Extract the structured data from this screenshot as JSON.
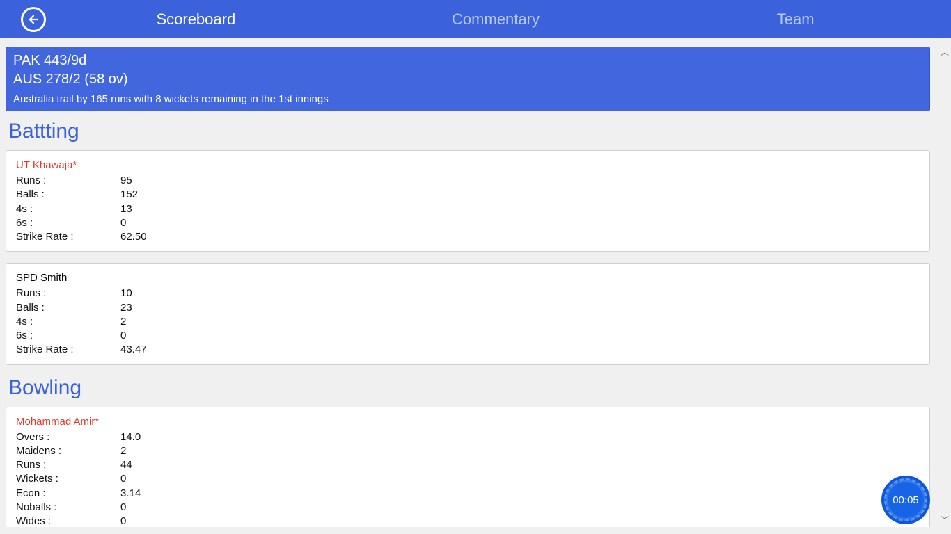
{
  "tabs": {
    "scoreboard": "Scoreboard",
    "commentary": "Commentary",
    "team": "Team"
  },
  "summary": {
    "line1": "PAK  443/9d",
    "line2": "AUS  278/2 (58 ov)",
    "status": "Australia trail by 165 runs with 8 wickets remaining in the 1st innings"
  },
  "batting": {
    "title": "Battting",
    "labels": {
      "runs": "Runs :",
      "balls": "Balls :",
      "fours": "4s :",
      "sixes": "6s :",
      "sr": "Strike Rate :"
    },
    "players": [
      {
        "name": "UT Khawaja*",
        "onstrike": true,
        "runs": "95",
        "balls": "152",
        "fours": "13",
        "sixes": "0",
        "sr": "62.50"
      },
      {
        "name": "SPD Smith",
        "onstrike": false,
        "runs": "10",
        "balls": "23",
        "fours": "2",
        "sixes": "0",
        "sr": "43.47"
      }
    ]
  },
  "bowling": {
    "title": "Bowling",
    "labels": {
      "overs": "Overs :",
      "maidens": "Maidens :",
      "runs": "Runs :",
      "wickets": "Wickets :",
      "econ": "Econ :",
      "noballs": "Noballs :",
      "wides": "Wides :"
    },
    "players": [
      {
        "name": "Mohammad Amir*",
        "onstrike": true,
        "overs": "14.0",
        "maidens": "2",
        "runs": "44",
        "wickets": "0",
        "econ": "3.14",
        "noballs": "0",
        "wides": "0"
      }
    ]
  },
  "timer": "00:05"
}
